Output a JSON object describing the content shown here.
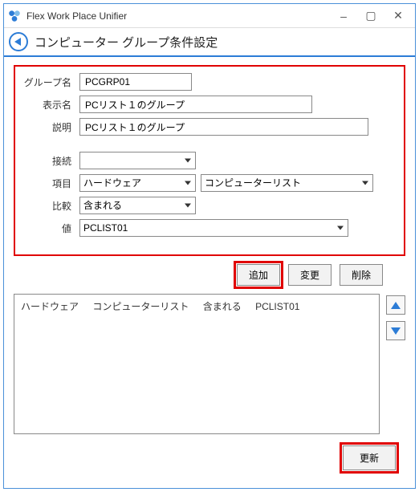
{
  "window": {
    "title": "Flex Work Place Unifier"
  },
  "subheader": {
    "title": "コンピューター グループ条件設定"
  },
  "form": {
    "labels": {
      "group_name": "グループ名",
      "display_name": "表示名",
      "description": "説明",
      "connection": "接続",
      "item": "項目",
      "compare": "比較",
      "value": "値"
    },
    "values": {
      "group_name": "PCGRP01",
      "display_name": "PCリスト１のグループ",
      "description": "PCリスト１のグループ",
      "connection": "",
      "item_left": "ハードウェア",
      "item_right": "コンピューターリスト",
      "compare": "含まれる",
      "value": "PCLIST01"
    }
  },
  "buttons": {
    "add": "追加",
    "change": "変更",
    "delete": "削除",
    "update": "更新"
  },
  "list": {
    "row0": {
      "c0": "ハードウェア",
      "c1": "コンピューターリスト",
      "c2": "含まれる",
      "c3": "PCLIST01"
    }
  }
}
